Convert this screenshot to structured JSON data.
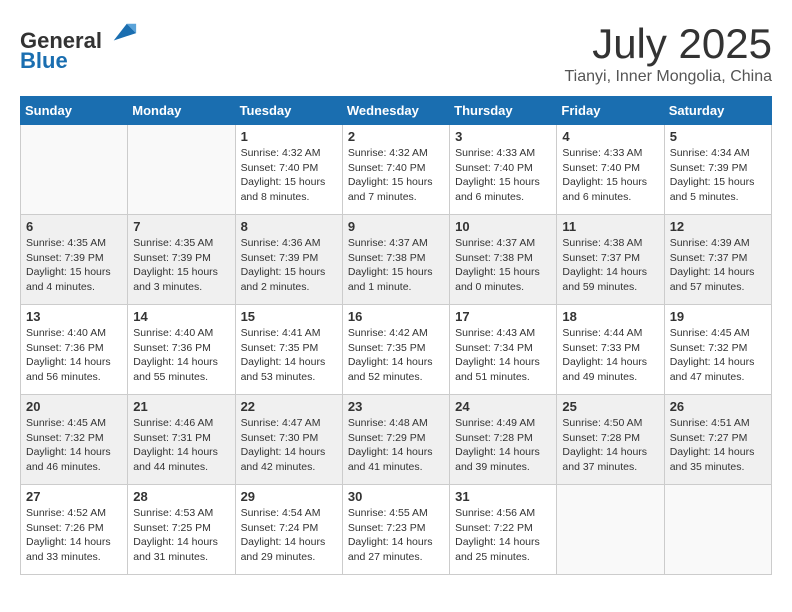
{
  "header": {
    "logo_general": "General",
    "logo_blue": "Blue",
    "month": "July 2025",
    "location": "Tianyi, Inner Mongolia, China"
  },
  "days_of_week": [
    "Sunday",
    "Monday",
    "Tuesday",
    "Wednesday",
    "Thursday",
    "Friday",
    "Saturday"
  ],
  "weeks": [
    [
      {
        "day": "",
        "info": ""
      },
      {
        "day": "",
        "info": ""
      },
      {
        "day": "1",
        "info": "Sunrise: 4:32 AM\nSunset: 7:40 PM\nDaylight: 15 hours\nand 8 minutes."
      },
      {
        "day": "2",
        "info": "Sunrise: 4:32 AM\nSunset: 7:40 PM\nDaylight: 15 hours\nand 7 minutes."
      },
      {
        "day": "3",
        "info": "Sunrise: 4:33 AM\nSunset: 7:40 PM\nDaylight: 15 hours\nand 6 minutes."
      },
      {
        "day": "4",
        "info": "Sunrise: 4:33 AM\nSunset: 7:40 PM\nDaylight: 15 hours\nand 6 minutes."
      },
      {
        "day": "5",
        "info": "Sunrise: 4:34 AM\nSunset: 7:39 PM\nDaylight: 15 hours\nand 5 minutes."
      }
    ],
    [
      {
        "day": "6",
        "info": "Sunrise: 4:35 AM\nSunset: 7:39 PM\nDaylight: 15 hours\nand 4 minutes."
      },
      {
        "day": "7",
        "info": "Sunrise: 4:35 AM\nSunset: 7:39 PM\nDaylight: 15 hours\nand 3 minutes."
      },
      {
        "day": "8",
        "info": "Sunrise: 4:36 AM\nSunset: 7:39 PM\nDaylight: 15 hours\nand 2 minutes."
      },
      {
        "day": "9",
        "info": "Sunrise: 4:37 AM\nSunset: 7:38 PM\nDaylight: 15 hours\nand 1 minute."
      },
      {
        "day": "10",
        "info": "Sunrise: 4:37 AM\nSunset: 7:38 PM\nDaylight: 15 hours\nand 0 minutes."
      },
      {
        "day": "11",
        "info": "Sunrise: 4:38 AM\nSunset: 7:37 PM\nDaylight: 14 hours\nand 59 minutes."
      },
      {
        "day": "12",
        "info": "Sunrise: 4:39 AM\nSunset: 7:37 PM\nDaylight: 14 hours\nand 57 minutes."
      }
    ],
    [
      {
        "day": "13",
        "info": "Sunrise: 4:40 AM\nSunset: 7:36 PM\nDaylight: 14 hours\nand 56 minutes."
      },
      {
        "day": "14",
        "info": "Sunrise: 4:40 AM\nSunset: 7:36 PM\nDaylight: 14 hours\nand 55 minutes."
      },
      {
        "day": "15",
        "info": "Sunrise: 4:41 AM\nSunset: 7:35 PM\nDaylight: 14 hours\nand 53 minutes."
      },
      {
        "day": "16",
        "info": "Sunrise: 4:42 AM\nSunset: 7:35 PM\nDaylight: 14 hours\nand 52 minutes."
      },
      {
        "day": "17",
        "info": "Sunrise: 4:43 AM\nSunset: 7:34 PM\nDaylight: 14 hours\nand 51 minutes."
      },
      {
        "day": "18",
        "info": "Sunrise: 4:44 AM\nSunset: 7:33 PM\nDaylight: 14 hours\nand 49 minutes."
      },
      {
        "day": "19",
        "info": "Sunrise: 4:45 AM\nSunset: 7:32 PM\nDaylight: 14 hours\nand 47 minutes."
      }
    ],
    [
      {
        "day": "20",
        "info": "Sunrise: 4:45 AM\nSunset: 7:32 PM\nDaylight: 14 hours\nand 46 minutes."
      },
      {
        "day": "21",
        "info": "Sunrise: 4:46 AM\nSunset: 7:31 PM\nDaylight: 14 hours\nand 44 minutes."
      },
      {
        "day": "22",
        "info": "Sunrise: 4:47 AM\nSunset: 7:30 PM\nDaylight: 14 hours\nand 42 minutes."
      },
      {
        "day": "23",
        "info": "Sunrise: 4:48 AM\nSunset: 7:29 PM\nDaylight: 14 hours\nand 41 minutes."
      },
      {
        "day": "24",
        "info": "Sunrise: 4:49 AM\nSunset: 7:28 PM\nDaylight: 14 hours\nand 39 minutes."
      },
      {
        "day": "25",
        "info": "Sunrise: 4:50 AM\nSunset: 7:28 PM\nDaylight: 14 hours\nand 37 minutes."
      },
      {
        "day": "26",
        "info": "Sunrise: 4:51 AM\nSunset: 7:27 PM\nDaylight: 14 hours\nand 35 minutes."
      }
    ],
    [
      {
        "day": "27",
        "info": "Sunrise: 4:52 AM\nSunset: 7:26 PM\nDaylight: 14 hours\nand 33 minutes."
      },
      {
        "day": "28",
        "info": "Sunrise: 4:53 AM\nSunset: 7:25 PM\nDaylight: 14 hours\nand 31 minutes."
      },
      {
        "day": "29",
        "info": "Sunrise: 4:54 AM\nSunset: 7:24 PM\nDaylight: 14 hours\nand 29 minutes."
      },
      {
        "day": "30",
        "info": "Sunrise: 4:55 AM\nSunset: 7:23 PM\nDaylight: 14 hours\nand 27 minutes."
      },
      {
        "day": "31",
        "info": "Sunrise: 4:56 AM\nSunset: 7:22 PM\nDaylight: 14 hours\nand 25 minutes."
      },
      {
        "day": "",
        "info": ""
      },
      {
        "day": "",
        "info": ""
      }
    ]
  ]
}
